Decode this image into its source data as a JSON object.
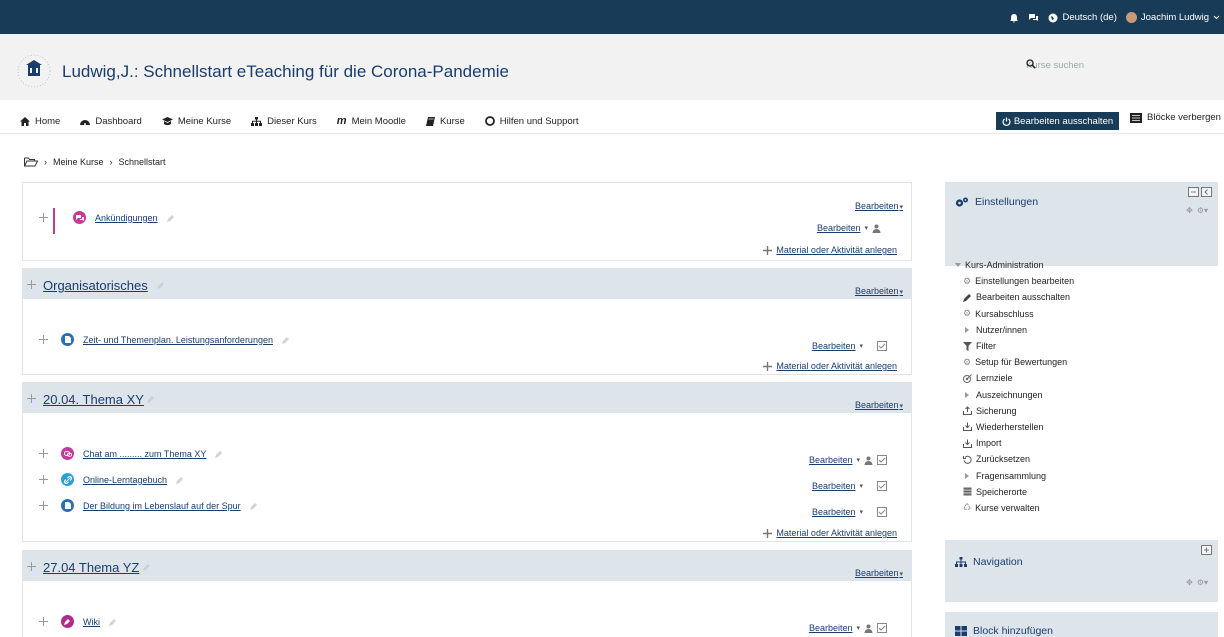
{
  "topbar": {
    "language": "Deutsch (de)",
    "user_name": "Joachim Ludwig",
    "icons": [
      "bell-icon",
      "chat-icon",
      "globe-icon",
      "avatar"
    ],
    "background": "#183c58"
  },
  "header": {
    "course_title": "Ludwig,J.: Schnellstart eTeaching für die Corona-Pandemie",
    "search_placeholder": "Kurse suchen"
  },
  "nav": {
    "items": [
      {
        "label": "Home",
        "icon": "home-icon"
      },
      {
        "label": "Dashboard",
        "icon": "dashboard-icon"
      },
      {
        "label": "Meine Kurse",
        "icon": "courses-icon"
      },
      {
        "label": "Dieser Kurs",
        "icon": "sitemap-icon"
      },
      {
        "label": "Mein Moodle",
        "icon": "moodle-icon"
      },
      {
        "label": "Kurse",
        "icon": "book-icon"
      },
      {
        "label": "Hilfen und Support",
        "icon": "lifebuoy-icon"
      }
    ],
    "edit_button": "Bearbeiten ausschalten",
    "blocks_button": "Blöcke verbergen"
  },
  "breadcrumb": {
    "items": [
      "Meine Kurse",
      "Schnellstart"
    ]
  },
  "common": {
    "edit_label": "Bearbeiten",
    "add_activity": "Material oder Aktivität anlegen"
  },
  "sections": [
    {
      "title": "",
      "activities": [
        {
          "label": "Ankündigungen",
          "icon": "forum-icon",
          "color": "#c43a9a"
        }
      ]
    },
    {
      "title": "Organisatorisches",
      "activities": [
        {
          "label": "Zeit- und Themenplan. Leistungsanforderungen",
          "icon": "file-icon",
          "color": "#2a6fb5"
        }
      ]
    },
    {
      "title": "20.04. Thema XY",
      "activities": [
        {
          "label": "Chat am ......... zum Thema XY",
          "icon": "chat-activity-icon",
          "color": "#c43a9a"
        },
        {
          "label": "Online-Lerntagebuch",
          "icon": "link-icon",
          "color": "#2a9fd6"
        },
        {
          "label": "Der Bildung im Lebenslauf auf der Spur",
          "icon": "file-icon",
          "color": "#2a6fb5"
        }
      ]
    },
    {
      "title": "27.04 Thema YZ",
      "activities": [
        {
          "label": "Wiki",
          "icon": "wiki-icon",
          "color": "#b02c8c"
        }
      ]
    }
  ],
  "sidebar": {
    "settings_title": "Einstellungen",
    "admin_title": "Kurs-Administration",
    "admin_items": [
      {
        "label": "Einstellungen bearbeiten",
        "icon": "gear-icon"
      },
      {
        "label": "Bearbeiten ausschalten",
        "icon": "pencil-icon"
      },
      {
        "label": "Kursabschluss",
        "icon": "gear-icon"
      },
      {
        "label": "Nutzer/innen",
        "icon": "caret-icon"
      },
      {
        "label": "Filter",
        "icon": "filter-icon"
      },
      {
        "label": "Setup für Bewertungen",
        "icon": "gear-icon"
      },
      {
        "label": "Lernziele",
        "icon": "target-icon"
      },
      {
        "label": "Auszeichnungen",
        "icon": "caret-icon"
      },
      {
        "label": "Sicherung",
        "icon": "upload-icon"
      },
      {
        "label": "Wiederherstellen",
        "icon": "download-icon"
      },
      {
        "label": "Import",
        "icon": "download-icon"
      },
      {
        "label": "Zurücksetzen",
        "icon": "reset-icon"
      },
      {
        "label": "Fragensammlung",
        "icon": "caret-icon"
      },
      {
        "label": "Speicherorte",
        "icon": "storage-icon"
      },
      {
        "label": "Kurse verwalten",
        "icon": "recycle-icon"
      }
    ],
    "navigation_title": "Navigation",
    "add_block_title": "Block hinzufügen"
  }
}
